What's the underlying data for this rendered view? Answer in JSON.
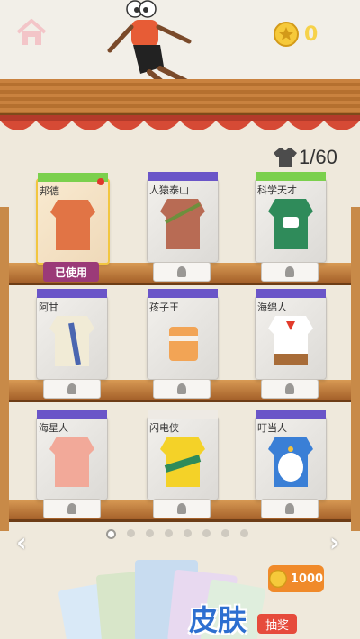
{
  "header": {
    "coin_amount": "0"
  },
  "collection": {
    "count": "1/60"
  },
  "skins": [
    {
      "name": "邦德",
      "status": "已使用"
    },
    {
      "name": "人猿泰山"
    },
    {
      "name": "科学天才"
    },
    {
      "name": "阿甘"
    },
    {
      "name": "孩子王"
    },
    {
      "name": "海绵人"
    },
    {
      "name": "海星人"
    },
    {
      "name": "闪电侠"
    },
    {
      "name": "叮当人"
    }
  ],
  "pager": {
    "total": 8,
    "current": 1
  },
  "draw": {
    "cost": "1000",
    "title": "皮肤",
    "subtitle": "抽奖"
  },
  "colors": {
    "coin": "#f6d24a",
    "used": "#9b3a78",
    "wood": "#c9823f",
    "brand_blue": "#2d6fd0"
  }
}
